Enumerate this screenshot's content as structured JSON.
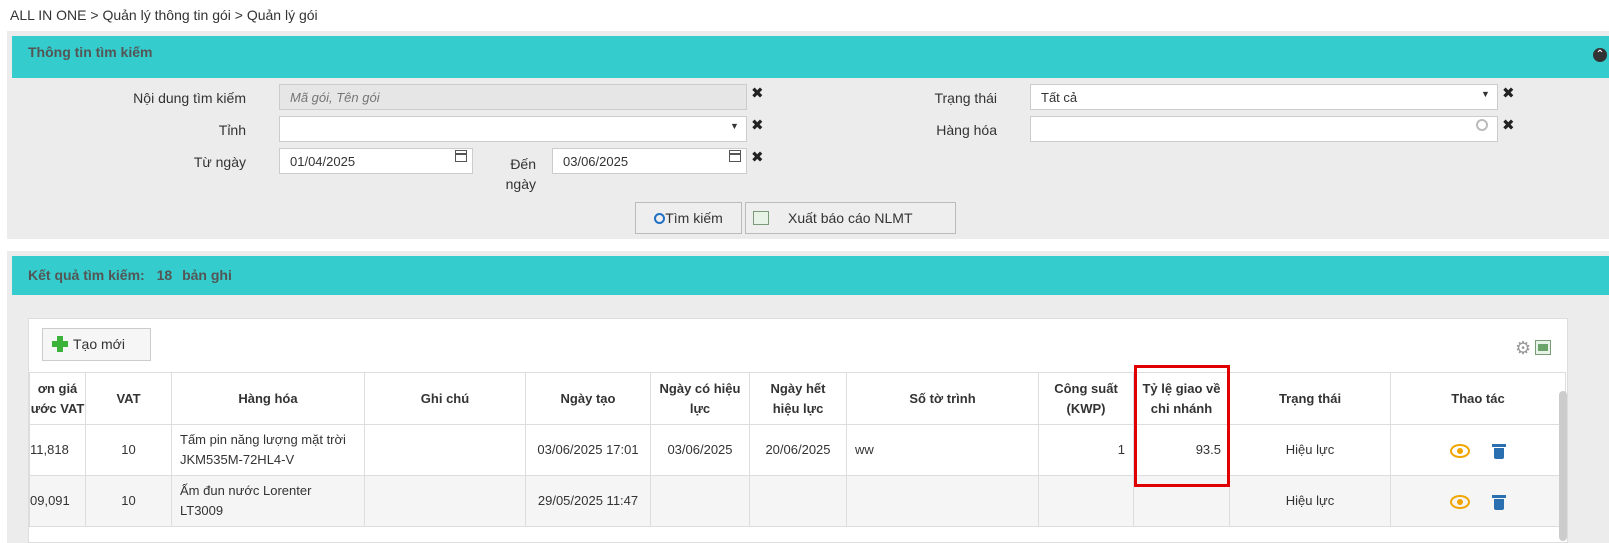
{
  "breadcrumb": "ALL IN ONE > Quản lý thông tin gói > Quản lý gói",
  "search_panel": {
    "title": "Thông tin tìm kiếm",
    "fields": {
      "keyword_label": "Nội dung tìm kiếm",
      "keyword_placeholder": "Mã gói, Tên gói",
      "province_label": "Tỉnh",
      "province_value": "",
      "from_label": "Từ ngày",
      "from_value": "01/04/2025",
      "to_label": "Đến ngày",
      "to_value": "03/06/2025",
      "status_label": "Trạng thái",
      "status_value": "Tất cả",
      "goods_label": "Hàng hóa",
      "goods_value": ""
    },
    "search_button": "Tìm kiếm",
    "export_button": "Xuất báo cáo NLMT"
  },
  "result_panel": {
    "title": "Kết quả tìm kiếm:",
    "count": "18",
    "count_suffix": "bản ghi",
    "new_button": "Tạo mới"
  },
  "table": {
    "headers": {
      "price": "ơn giá ước VAT",
      "vat": "VAT",
      "goods": "Hàng hóa",
      "note": "Ghi chú",
      "created": "Ngày tạo",
      "effective": "Ngày có hiệu lực",
      "expire": "Ngày hết hiệu lực",
      "proposal": "Số tờ trình",
      "capacity": "Công suất (KWP)",
      "ratio": "Tỷ lệ giao về chi nhánh",
      "status": "Trạng thái",
      "actions": "Thao tác"
    },
    "rows": [
      {
        "price": "11,818",
        "vat": "10",
        "goods": "Tấm pin năng lượng mặt trời JKM535M-72HL4-V",
        "note": "",
        "created": "03/06/2025 17:01",
        "effective": "03/06/2025",
        "expire": "20/06/2025",
        "proposal": "ww",
        "capacity": "1",
        "ratio": "93.5",
        "status": "Hiệu lực"
      },
      {
        "price": "09,091",
        "vat": "10",
        "goods": "Ấm đun nước Lorenter LT3009",
        "note": "",
        "created": "29/05/2025 11:47",
        "effective": "",
        "expire": "",
        "proposal": "",
        "capacity": "",
        "ratio": "",
        "status": "Hiệu lực"
      }
    ]
  },
  "colors": {
    "header_bar": "#34cccc",
    "eye": "#f0a500",
    "trash": "#2a6fb0",
    "highlight": "#e00000"
  }
}
